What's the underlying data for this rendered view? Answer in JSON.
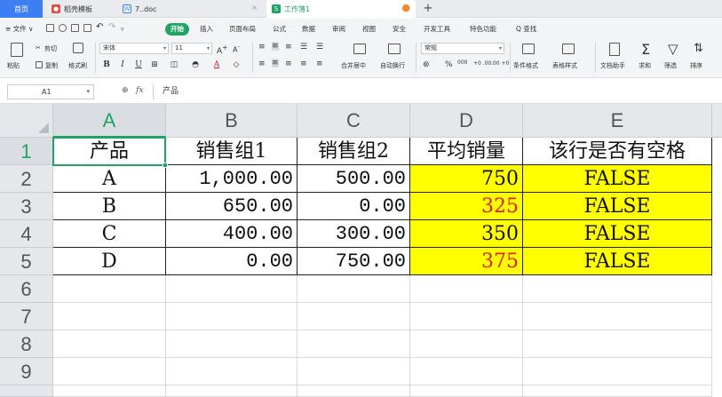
{
  "tabs": {
    "home": "首页",
    "t1": "稻壳模板",
    "t2": "7..doc",
    "t3": "工作簿1",
    "t2_icon": "W",
    "t3_icon": "S",
    "close": "×",
    "modified": "●",
    "new": "+"
  },
  "menu": {
    "file": "≡ 文件 ∨",
    "start": "开始",
    "items": [
      "插入",
      "页面布局",
      "公式",
      "数据",
      "审阅",
      "视图",
      "安全",
      "开发工具",
      "特色功能"
    ],
    "search": "Q 查找"
  },
  "ribbon": {
    "paste": "粘贴",
    "cut": "剪切",
    "copy": "复制",
    "format_painter": "格式刷",
    "font_name": "宋体",
    "font_size": "11",
    "bold": "B",
    "italic": "I",
    "underline": "U",
    "merge_center": "合并居中",
    "wrap": "自动换行",
    "number_format": "常规",
    "percent": "%",
    "thousands": "000",
    "inc_decimal": "+0 .00",
    "dec_decimal": ".00 +0",
    "conditional_format": "条件格式",
    "table_style": "表格样式",
    "doc_helper": "文档助手",
    "sum": "求和",
    "filter": "筛选",
    "sort": "排序"
  },
  "formula_bar": {
    "cell_ref": "A1",
    "fx": "fx",
    "content": "产品"
  },
  "columns": [
    "A",
    "B",
    "C",
    "D",
    "E"
  ],
  "rows": [
    "1",
    "2",
    "3",
    "4",
    "5",
    "6",
    "7",
    "8",
    "9"
  ],
  "table": {
    "headers": [
      "产品",
      "销售组1",
      "销售组2",
      "平均销量",
      "该行是否有空格"
    ],
    "data": [
      [
        "A",
        "1,000.00",
        "500.00",
        "750",
        "FALSE"
      ],
      [
        "B",
        "650.00",
        "0.00",
        "325",
        "FALSE"
      ],
      [
        "C",
        "400.00",
        "300.00",
        "350",
        "FALSE"
      ],
      [
        "D",
        "0.00",
        "750.00",
        "375",
        "FALSE"
      ]
    ]
  },
  "colors": {
    "accent": "#1fa463",
    "highlight": "#ffff00",
    "red_value": "#e02020"
  }
}
